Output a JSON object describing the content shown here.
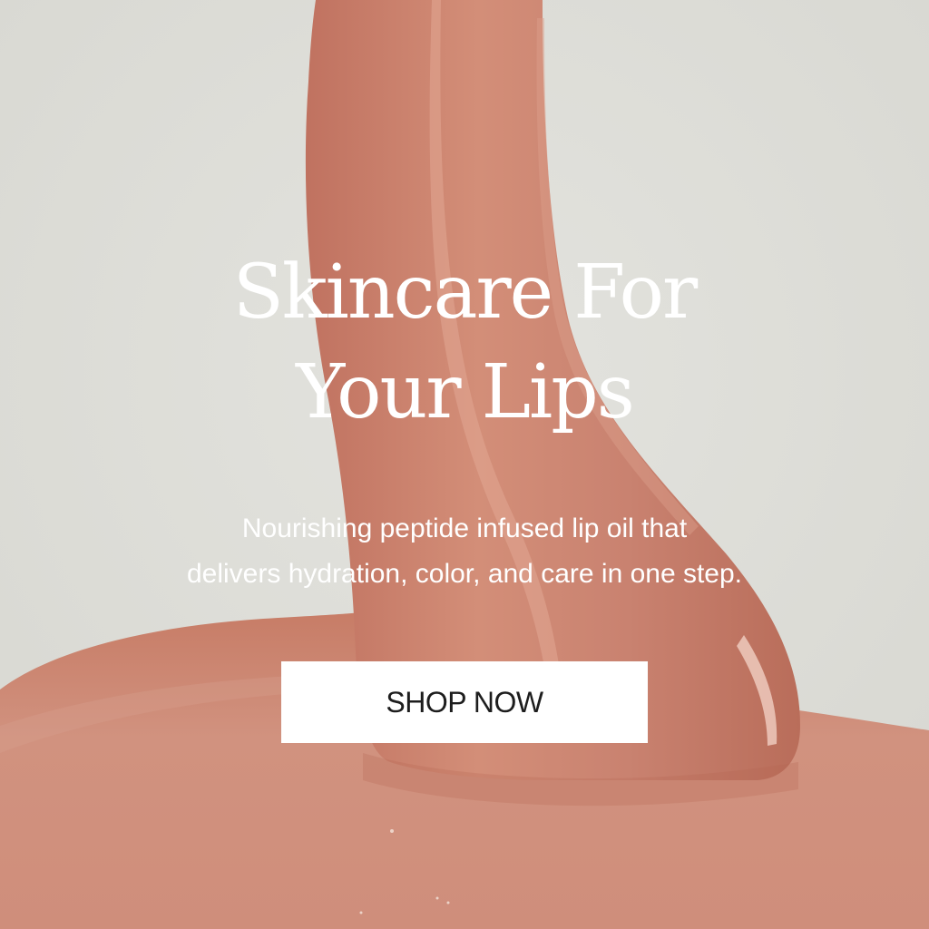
{
  "hero": {
    "headline_line1": "Skincare For",
    "headline_line2": "Your Lips",
    "subcopy_line1": "Nourishing peptide infused lip oil that",
    "subcopy_line2": "delivers hydration, color, and care in one step.",
    "cta_label": "SHOP NOW"
  },
  "colors": {
    "background": "#dfdfda",
    "product_oil": "#c9806a",
    "text": "#ffffff",
    "button_bg": "#ffffff",
    "button_text": "#1d1d1d"
  }
}
